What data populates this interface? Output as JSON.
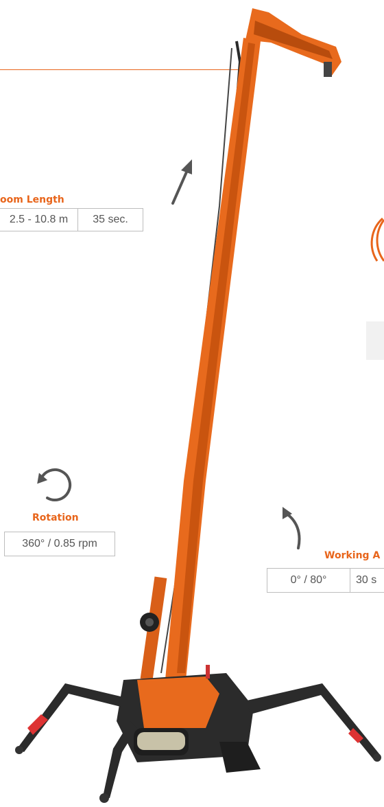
{
  "specs": {
    "boom_length": {
      "label": "oom Length",
      "range": "2.5 - 10.8 m",
      "time": "35 sec."
    },
    "rotation": {
      "label": "Rotation",
      "value": "360° / 0.85 rpm"
    },
    "working_angle": {
      "label": "Working A",
      "angle": "0° / 80°",
      "time": "30 s"
    }
  },
  "colors": {
    "accent": "#e8651b",
    "crane_orange": "#e86a1d",
    "crane_dark": "#2b2b2b",
    "border": "#bdbdbd"
  },
  "icons": [
    "up-arrow-icon",
    "rotation-icon",
    "curved-arrow-icon"
  ]
}
